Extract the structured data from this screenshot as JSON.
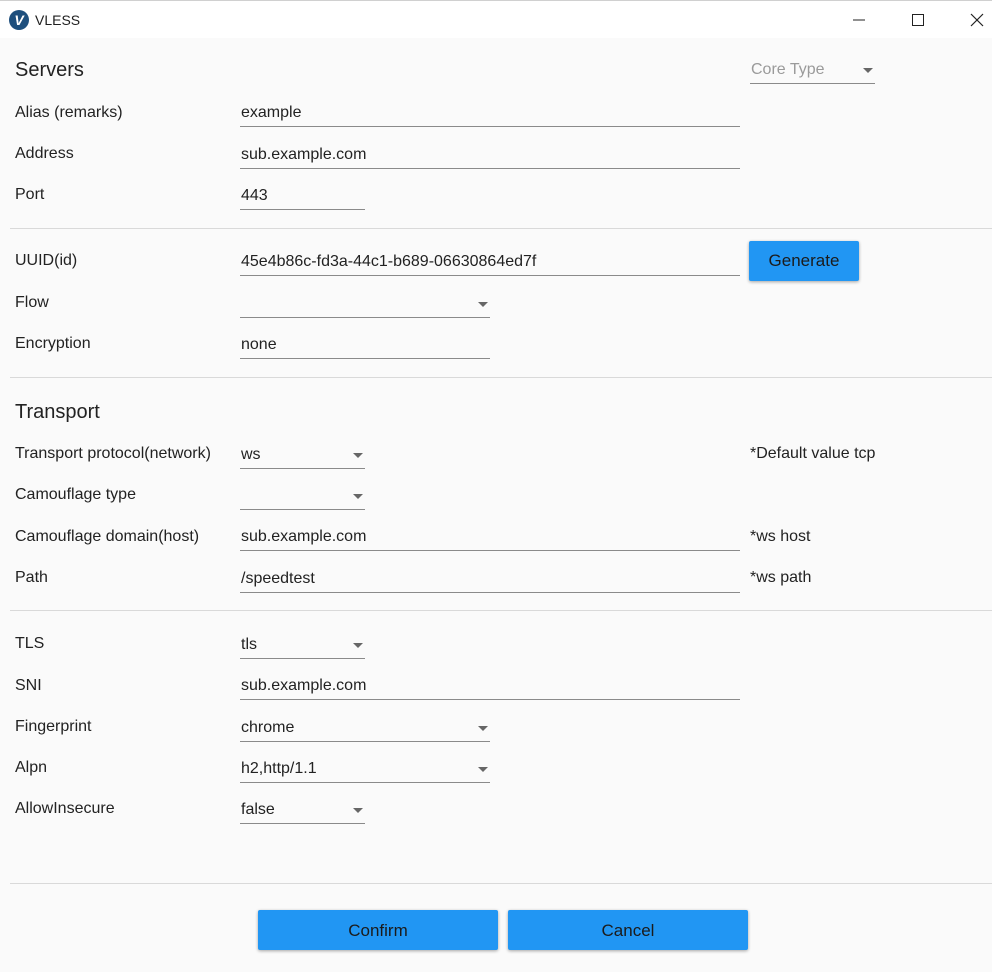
{
  "window": {
    "title": "VLESS",
    "icon_letter": "V",
    "controls": [
      "minimize-icon",
      "maximize-icon",
      "close-icon"
    ]
  },
  "servers": {
    "title": "Servers",
    "core_type_placeholder": "Core Type",
    "alias_label": "Alias (remarks)",
    "alias_value": "example",
    "address_label": "Address",
    "address_value": "sub.example.com",
    "port_label": "Port",
    "port_value": "443"
  },
  "user": {
    "uuid_label": "UUID(id)",
    "uuid_value": "45e4b86c-fd3a-44c1-b689-06630864ed7f",
    "generate_label": "Generate",
    "flow_label": "Flow",
    "flow_value": "",
    "encryption_label": "Encryption",
    "encryption_value": "none"
  },
  "transport": {
    "title": "Transport",
    "network_label": "Transport protocol(network)",
    "network_value": "ws",
    "network_hint": "*Default value tcp",
    "camouflage_type_label": "Camouflage type",
    "camouflage_type_value": "",
    "host_label": "Camouflage domain(host)",
    "host_value": "sub.example.com",
    "host_hint": "*ws host",
    "path_label": "Path",
    "path_value": "/speedtest",
    "path_hint": "*ws path"
  },
  "tls": {
    "tls_label": "TLS",
    "tls_value": "tls",
    "sni_label": "SNI",
    "sni_value": "sub.example.com",
    "fingerprint_label": "Fingerprint",
    "fingerprint_value": "chrome",
    "alpn_label": "Alpn",
    "alpn_value": "h2,http/1.1",
    "allow_insecure_label": "AllowInsecure",
    "allow_insecure_value": "false"
  },
  "footer": {
    "confirm_label": "Confirm",
    "cancel_label": "Cancel"
  },
  "colors": {
    "accent": "#2196f3",
    "background": "#fafafa",
    "app_icon": "#1e4f7d"
  }
}
